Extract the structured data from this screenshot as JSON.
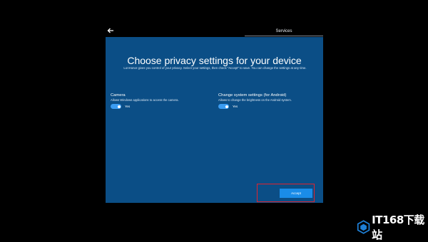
{
  "header": {
    "tab_label": "Services"
  },
  "dialog": {
    "title": "Choose privacy settings for your device",
    "subtitle": "LonHonor gives you control of your privacy. Select your settings, then check \"Accept\" to save. You can change the settings at any time."
  },
  "settings": [
    {
      "title": "Camera",
      "description": "Allows Windows applications to access the camera.",
      "toggle_state": "Yes",
      "enabled": true
    },
    {
      "title": "Change system settings (for Android)",
      "description": "Allows to change the brightness on the Android system.",
      "toggle_state": "Yes",
      "enabled": true
    }
  ],
  "footer": {
    "accept_label": "Accept"
  },
  "watermark": {
    "text": "IT168下载站"
  },
  "colors": {
    "background": "#000000",
    "panel": "#0b4e86",
    "toggle_on": "#3b9cf2",
    "accept_button": "#1a8ce8",
    "highlight_border": "#e0232e"
  }
}
